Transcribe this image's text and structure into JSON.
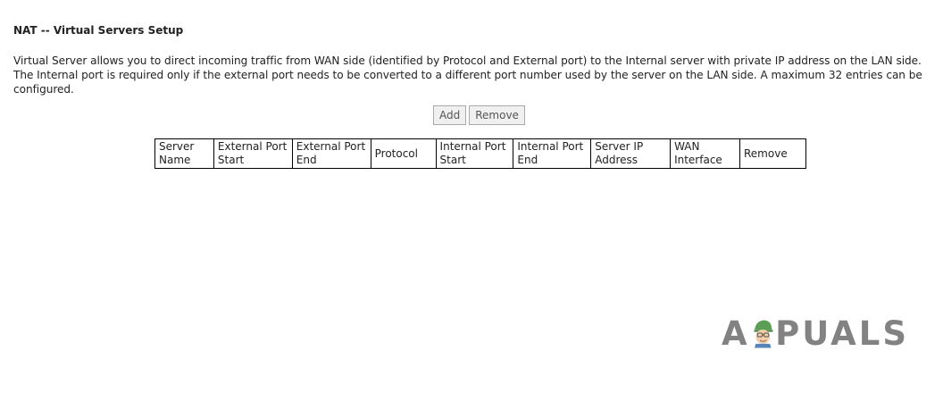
{
  "page": {
    "title": "NAT -- Virtual Servers Setup",
    "description": "Virtual Server allows you to direct incoming traffic from WAN side (identified by Protocol and External port) to the Internal server with private IP address on the LAN side. The Internal port is required only if the external port needs to be converted to a different port number used by the server on the LAN side. A maximum 32 entries can be configured."
  },
  "buttons": {
    "add_label": "Add",
    "remove_label": "Remove"
  },
  "table": {
    "headers": [
      {
        "line1": "Server",
        "line2": "Name"
      },
      {
        "line1": "External Port",
        "line2": "Start"
      },
      {
        "line1": "External Port",
        "line2": "End"
      },
      {
        "line1": "Protocol",
        "line2": ""
      },
      {
        "line1": "Internal Port",
        "line2": "Start"
      },
      {
        "line1": "Internal Port",
        "line2": "End"
      },
      {
        "line1": "Server IP",
        "line2": "Address"
      },
      {
        "line1": "WAN",
        "line2": "Interface"
      },
      {
        "line1": "Remove",
        "line2": ""
      }
    ],
    "rows": []
  },
  "watermark": {
    "text_a": "A",
    "text_rest": "PUALS",
    "colors": {
      "text": "#6d6d6d",
      "hat": "#3f8f3a",
      "face": "#f2c79b"
    }
  }
}
